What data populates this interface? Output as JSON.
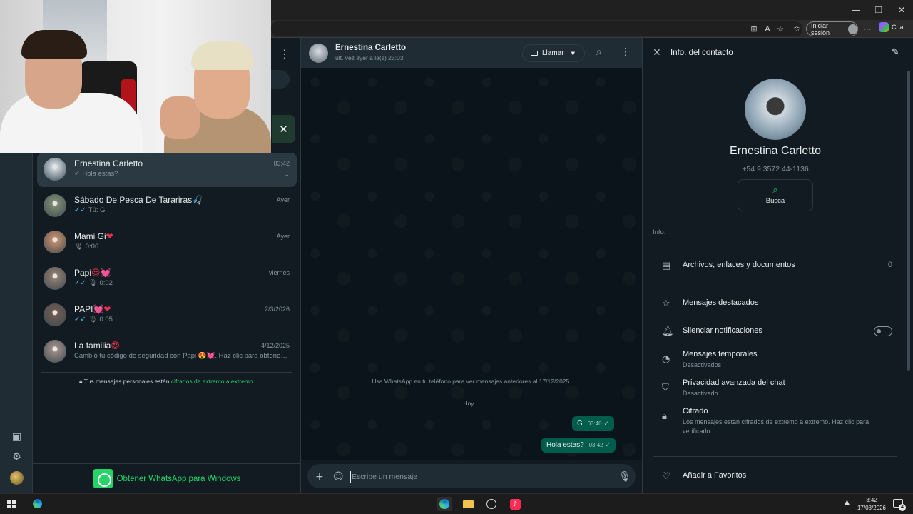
{
  "browser": {
    "window_controls": [
      "—",
      "❐",
      "✕"
    ],
    "signin_label": "Iniciar sesión",
    "chat_label": "Chat"
  },
  "chat_list": {
    "chats": [
      {
        "name": "Ernestina Carletto",
        "time": "03:42",
        "preview": "Hola estas?",
        "tick": "single",
        "active": true,
        "pic_color": "#c9d3da"
      },
      {
        "name": "Sábado De Pesca De Tarariras",
        "name_suffix": "🎣",
        "time": "Ayer",
        "preview": "Tú: G",
        "tick": "double-blue",
        "pic_color": "#7c8a72"
      },
      {
        "name": "Mami Gi",
        "name_suffix": "❤",
        "time": "Ayer",
        "preview": "0:06",
        "tick": "mic",
        "pic_color": "#c08a6a"
      },
      {
        "name": "Papi",
        "name_suffix": "😍💓",
        "time": "viernes",
        "preview": "0:02",
        "tick": "double-blue-mic",
        "pic_color": "#8d7b6e"
      },
      {
        "name": "PAPI",
        "name_suffix": "💓❤",
        "time": "2/3/2026",
        "preview": "0:05",
        "tick": "double-blue-mic",
        "pic_color": "#6d5a52"
      },
      {
        "name": "La familia",
        "name_suffix": "😍",
        "time": "4/12/2025",
        "preview": "Cambió tu código de seguridad con Papi 😍💓. Haz clic para obtener ...",
        "tick": "none",
        "pic_color": "#9a8a84"
      }
    ],
    "e2e_text": "Tus mensajes personales están",
    "e2e_link": "cifrados de extremo a extremo.",
    "get_whatsapp": "Obtener WhatsApp para Windows"
  },
  "conversation": {
    "name": "Ernestina Carletto",
    "last_seen": "últ. vez ayer a la(s) 23:03",
    "call_label": "Llamar",
    "system_message": "Usa WhatsApp en tu teléfono para ver mensajes anteriores al 17/12/2025.",
    "day_label": "Hoy",
    "messages": [
      {
        "text": "G",
        "time": "03:40"
      },
      {
        "text": "Hola estas?",
        "time": "03:42"
      }
    ],
    "composer_placeholder": "Escribe un mensaje"
  },
  "contact_info": {
    "title": "Info. del contacto",
    "name": "Ernestina Carletto",
    "phone": "+54 9 3572 44-1136",
    "search_label": "Busca",
    "section_label": "Info.",
    "files_label": "Archivos, enlaces y documentos",
    "files_count": "0",
    "starred_label": "Mensajes destacados",
    "mute_label": "Silenciar notificaciones",
    "mute_enabled": false,
    "temp_label": "Mensajes temporales",
    "temp_status": "Desactivados",
    "privacy_label": "Privacidad avanzada del chat",
    "privacy_status": "Desactivado",
    "encryption_label": "Cifrado",
    "encryption_desc": "Los mensajes están cifrados de extremo a extremo. Haz clic para verificarlo.",
    "favorites_label": "Añadir a Favoritos"
  },
  "taskbar": {
    "time": "3:42",
    "date": "17/03/2026",
    "notification_count": "4"
  },
  "colors": {
    "accent": "#25d366",
    "bubble": "#005c4b",
    "panel": "#111b21",
    "header": "#202c33",
    "read_tick": "#53bdeb"
  }
}
